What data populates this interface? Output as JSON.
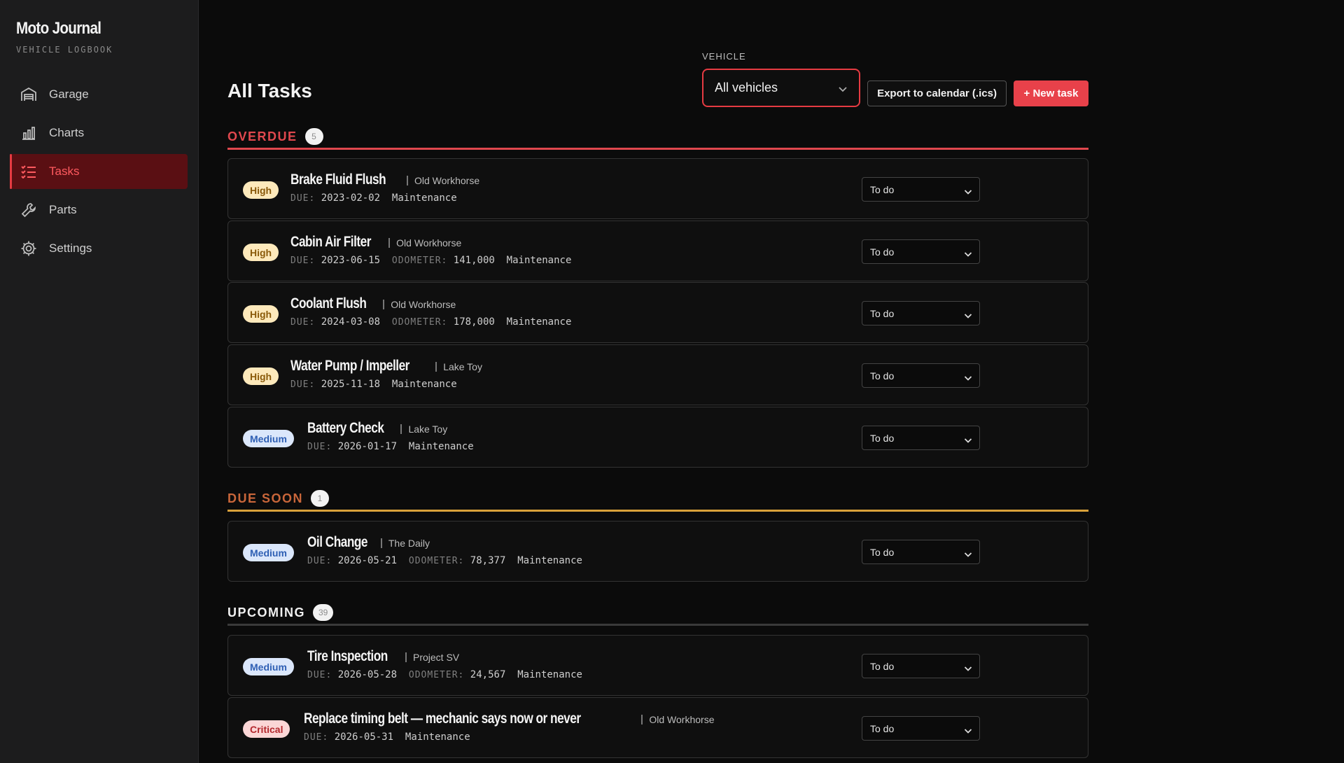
{
  "app": {
    "title": "Moto Journal",
    "subtitle": "VEHICLE LOGBOOK"
  },
  "nav": [
    {
      "label": "Garage",
      "icon": "garage-icon"
    },
    {
      "label": "Charts",
      "icon": "bar-chart-icon"
    },
    {
      "label": "Tasks",
      "icon": "checklist-icon",
      "active": true
    },
    {
      "label": "Parts",
      "icon": "wrench-icon"
    },
    {
      "label": "Settings",
      "icon": "gear-icon"
    }
  ],
  "header": {
    "title": "All Tasks",
    "vehicle_label": "VEHICLE",
    "vehicle_value": "All vehicles",
    "export_label": "Export to calendar (.ics)",
    "new_label": "+ New task"
  },
  "colors": {
    "accent": "#e8414a",
    "overdue": "#e8414a",
    "due_soon": "#d9a13a",
    "upcoming": "#3a3a3a"
  },
  "meta_labels": {
    "due": "DUE:",
    "odometer": "ODOMETER:"
  },
  "sections": [
    {
      "title": "OVERDUE",
      "count": "5",
      "color": "#e0484e",
      "tasks": [
        {
          "priority": "High",
          "name": "Brake Fluid Flush",
          "vehicle": "Old Workhorse",
          "due": "2023-02-02",
          "odometer": "",
          "category": "Maintenance",
          "status": "To do"
        },
        {
          "priority": "High",
          "name": "Cabin Air Filter",
          "vehicle": "Old Workhorse",
          "due": "2023-06-15",
          "odometer": "141,000",
          "category": "Maintenance",
          "status": "To do"
        },
        {
          "priority": "High",
          "name": "Coolant Flush",
          "vehicle": "Old Workhorse",
          "due": "2024-03-08",
          "odometer": "178,000",
          "category": "Maintenance",
          "status": "To do"
        },
        {
          "priority": "High",
          "name": "Water Pump / Impeller",
          "vehicle": "Lake Toy",
          "due": "2025-11-18",
          "odometer": "",
          "category": "Maintenance",
          "status": "To do"
        },
        {
          "priority": "Medium",
          "name": "Battery Check",
          "vehicle": "Lake Toy",
          "due": "2026-01-17",
          "odometer": "",
          "category": "Maintenance",
          "status": "To do"
        }
      ]
    },
    {
      "title": "DUE SOON",
      "count": "1",
      "color": "#c9663a",
      "tasks": [
        {
          "priority": "Medium",
          "name": "Oil Change",
          "vehicle": "The Daily",
          "due": "2026-05-21",
          "odometer": "78,377",
          "category": "Maintenance",
          "status": "To do"
        }
      ]
    },
    {
      "title": "UPCOMING",
      "count": "39",
      "color": "#f0f0f0",
      "tasks": [
        {
          "priority": "Medium",
          "name": "Tire Inspection",
          "vehicle": "Project SV",
          "due": "2026-05-28",
          "odometer": "24,567",
          "category": "Maintenance",
          "status": "To do"
        },
        {
          "priority": "Critical",
          "name": "Replace timing belt — mechanic says now or never",
          "vehicle": "Old Workhorse",
          "due": "2026-05-31",
          "odometer": "",
          "category": "Maintenance",
          "status": "To do"
        }
      ]
    }
  ]
}
